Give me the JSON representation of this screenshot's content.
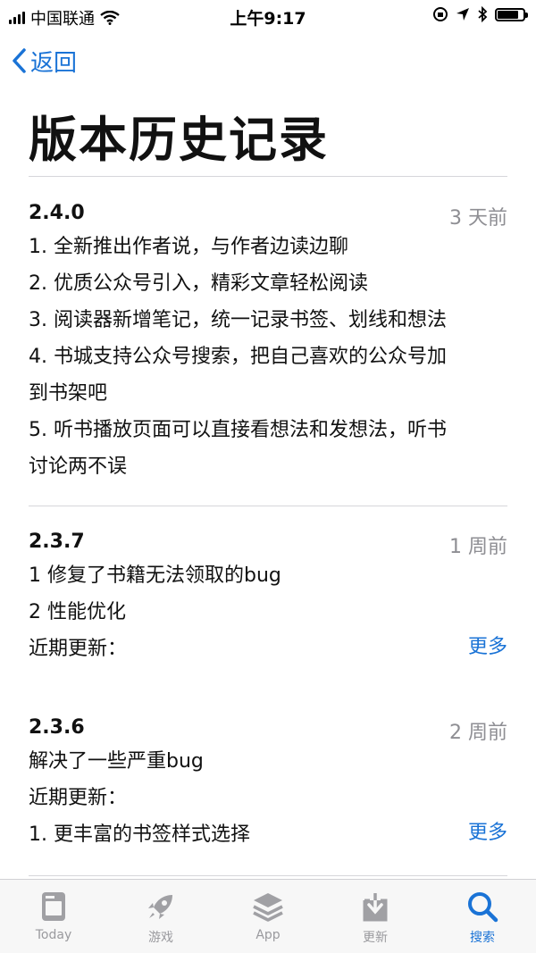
{
  "status_bar": {
    "carrier": "中国联通",
    "time": "上午9:17"
  },
  "nav": {
    "back_label": "返回"
  },
  "page_title": "版本历史记录",
  "releases": [
    {
      "version": "2.4.0",
      "date": "3 天前",
      "lines": [
        "1. 全新推出作者说，与作者边读边聊",
        "2. 优质公众号引入，精彩文章轻松阅读",
        "3. 阅读器新增笔记，统一记录书签、划线和想法",
        "4. 书城支持公众号搜索，把自己喜欢的公众号加",
        "到书架吧",
        "5. 听书播放页面可以直接看想法和发想法，听书",
        "讨论两不误"
      ]
    },
    {
      "version": "2.3.7",
      "date": "1 周前",
      "lines": [
        "1 修复了书籍无法领取的bug",
        "2 性能优化",
        "近期更新："
      ],
      "more": "更多"
    },
    {
      "version": "2.3.6",
      "date": "2 周前",
      "lines": [
        "解决了一些严重bug",
        "近期更新：",
        "1. 更丰富的书签样式选择"
      ],
      "more": "更多"
    }
  ],
  "tab_bar": {
    "tabs": [
      {
        "label": "Today",
        "icon": "today-icon",
        "active": false
      },
      {
        "label": "游戏",
        "icon": "rocket-icon",
        "active": false
      },
      {
        "label": "App",
        "icon": "layers-icon",
        "active": false
      },
      {
        "label": "更新",
        "icon": "download-icon",
        "active": false
      },
      {
        "label": "搜索",
        "icon": "search-icon",
        "active": true
      }
    ],
    "active_color": "#1a73d6",
    "inactive_color": "#9a9a9e"
  }
}
